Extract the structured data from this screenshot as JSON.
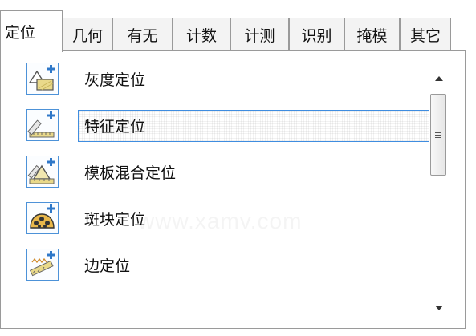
{
  "tabs": [
    {
      "label": "定位",
      "active": true
    },
    {
      "label": "几何",
      "active": false
    },
    {
      "label": "有无",
      "active": false
    },
    {
      "label": "计数",
      "active": false
    },
    {
      "label": "计测",
      "active": false
    },
    {
      "label": "识别",
      "active": false
    },
    {
      "label": "掩模",
      "active": false
    },
    {
      "label": "其它",
      "active": false
    }
  ],
  "list": {
    "items": [
      {
        "label": "灰度定位",
        "icon": "gray-locate-icon",
        "selected": false
      },
      {
        "label": "特征定位",
        "icon": "feature-locate-icon",
        "selected": true
      },
      {
        "label": "模板混合定位",
        "icon": "template-mix-locate-icon",
        "selected": false
      },
      {
        "label": "斑块定位",
        "icon": "blob-locate-icon",
        "selected": false
      },
      {
        "label": "边定位",
        "icon": "edge-locate-icon",
        "selected": false
      }
    ]
  },
  "watermark": "www.xamv.com",
  "colors": {
    "accent": "#3f8de0",
    "plus": "#2f78c8",
    "border": "#9a9a9a"
  }
}
